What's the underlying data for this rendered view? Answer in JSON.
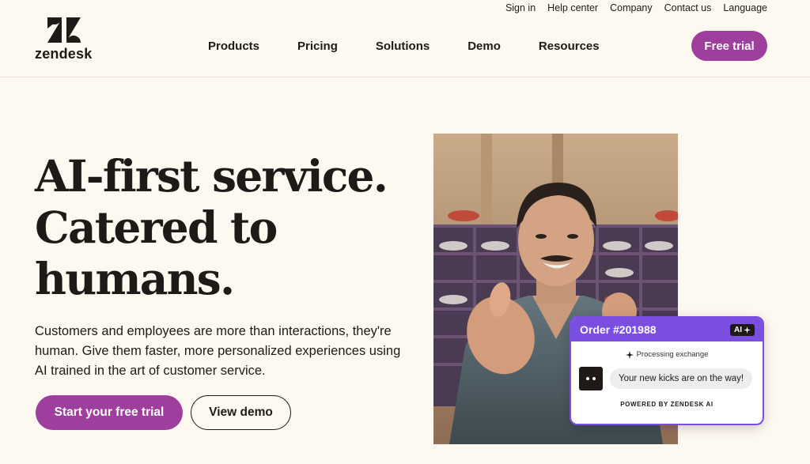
{
  "brand": {
    "name": "zendesk"
  },
  "utility_nav": [
    "Sign in",
    "Help center",
    "Company",
    "Contact us",
    "Language"
  ],
  "main_nav": [
    "Products",
    "Pricing",
    "Solutions",
    "Demo",
    "Resources"
  ],
  "header": {
    "cta_label": "Free trial"
  },
  "hero": {
    "title_lines": [
      "AI-first service.",
      "Catered to",
      "humans."
    ],
    "subtitle": "Customers and employees are more than interactions, they're human. Give them faster, more personalized experiences using AI trained in the art of customer service.",
    "cta_primary": "Start your free trial",
    "cta_secondary": "View demo"
  },
  "chat_card": {
    "order": "Order #201988",
    "ai_badge": "AI",
    "status": "Processing exchange",
    "message": "Your new kicks are on the way!",
    "footer": "POWERED BY ZENDESK AI"
  },
  "colors": {
    "background": "#fdf8f0",
    "accent": "#9e3f9e",
    "chat_accent": "#7a4fe0",
    "text": "#1f1a17"
  }
}
